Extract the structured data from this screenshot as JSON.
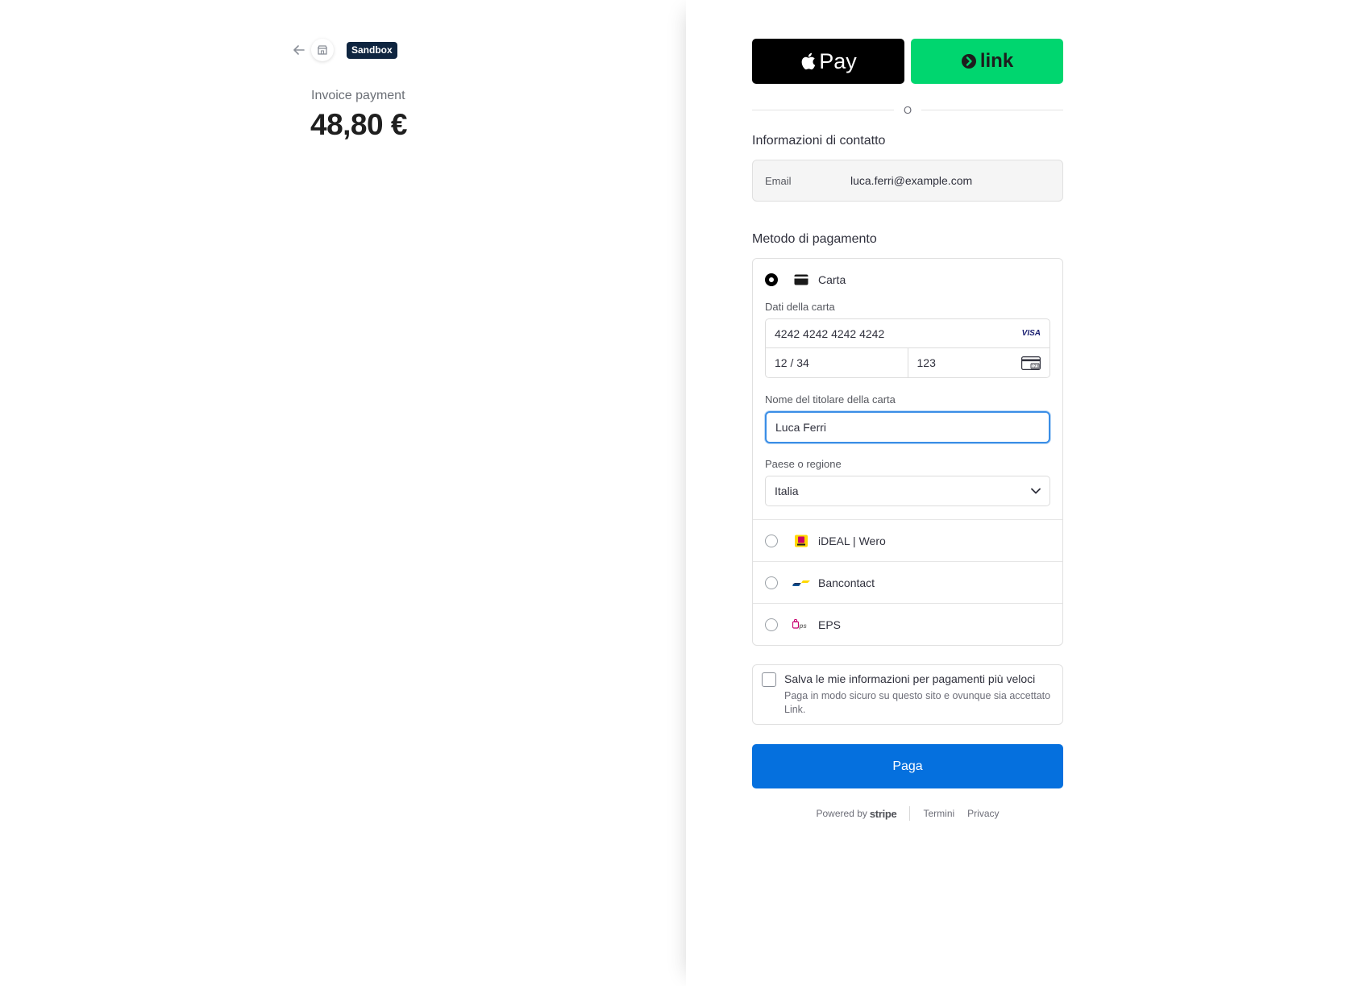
{
  "header": {
    "sandbox_label": "Sandbox",
    "invoice_label": "Invoice payment",
    "amount": "48,80 €"
  },
  "wallets": {
    "apple_pay_label": "Pay",
    "link_label": "link"
  },
  "divider_text": "O",
  "contact": {
    "title": "Informazioni di contatto",
    "email_label": "Email",
    "email_value": "luca.ferri@example.com"
  },
  "payment": {
    "title": "Metodo di pagamento",
    "card": {
      "label": "Carta",
      "details_label": "Dati della carta",
      "number": "4242 4242 4242 4242",
      "brand": "VISA",
      "expiry": "12 / 34",
      "cvc": "123",
      "holder_label": "Nome del titolare della carta",
      "holder_value": "Luca Ferri",
      "country_label": "Paese o regione",
      "country_value": "Italia"
    },
    "methods": [
      {
        "label": "iDEAL | Wero",
        "icon": "ideal-icon"
      },
      {
        "label": "Bancontact",
        "icon": "bancontact-icon"
      },
      {
        "label": "EPS",
        "icon": "eps-icon"
      }
    ]
  },
  "save": {
    "title": "Salva le mie informazioni per pagamenti più veloci",
    "description": "Paga in modo sicuro su questo sito e ovunque sia accettato Link."
  },
  "pay_button": "Paga",
  "footer": {
    "powered_by": "Powered by",
    "stripe": "stripe",
    "terms": "Termini",
    "privacy": "Privacy"
  },
  "colors": {
    "pay_button": "#0570de",
    "link_green": "#00d66f",
    "sandbox_badge": "#0f2540",
    "focus_border": "#3a8ee6"
  }
}
